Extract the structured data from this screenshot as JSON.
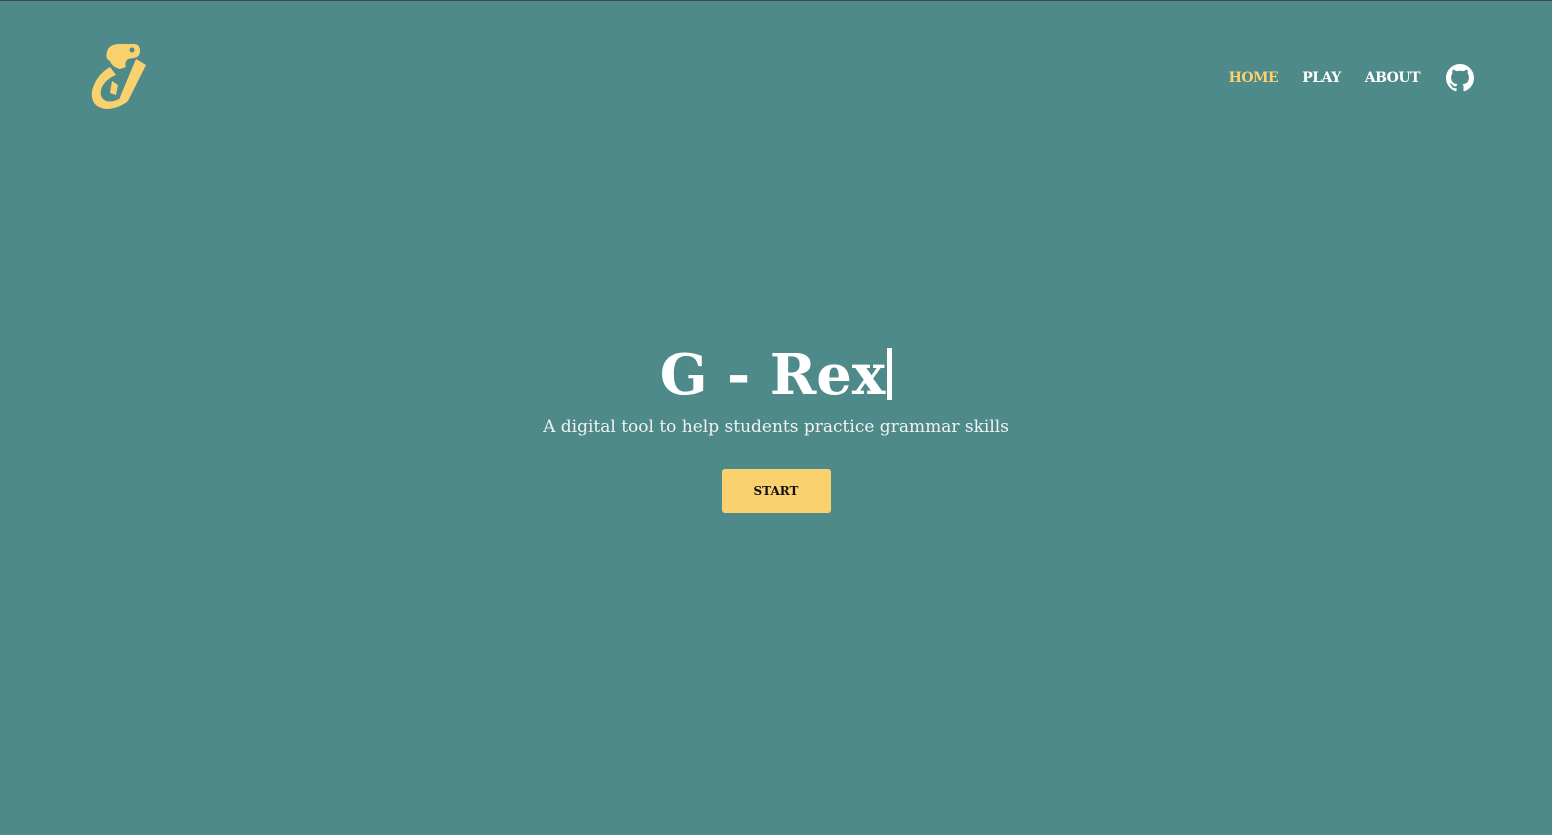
{
  "nav": {
    "items": [
      {
        "label": "HOME",
        "active": true
      },
      {
        "label": "PLAY",
        "active": false
      },
      {
        "label": "ABOUT",
        "active": false
      }
    ],
    "github_icon": "github-icon"
  },
  "logo_icon": "trex-pencil-logo",
  "hero": {
    "title": "G - Rex",
    "subtitle": "A digital tool to help students practice grammar skills",
    "start_label": "START"
  },
  "colors": {
    "background": "#4e8a89",
    "accent": "#f9d16e"
  }
}
